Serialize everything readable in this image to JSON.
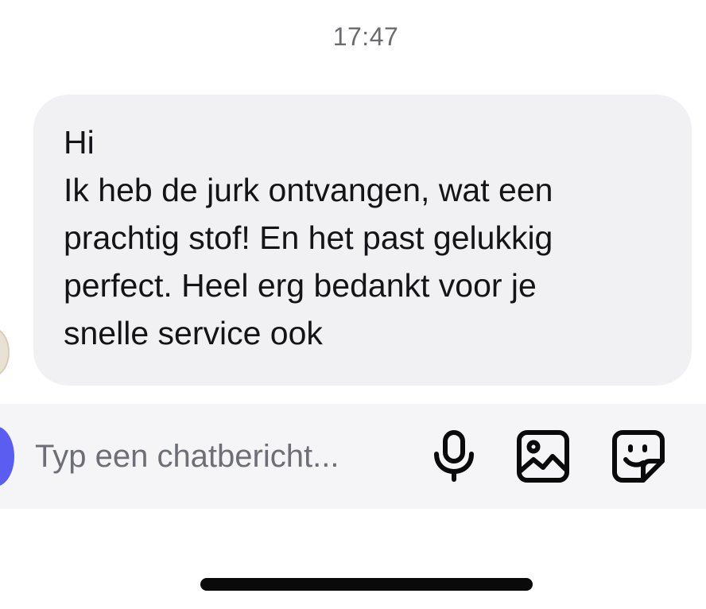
{
  "timestamp": "17:47",
  "message": {
    "text": "Hi\nIk heb de jurk ontvangen, wat een\nprachtig stof! En het past gelukkig\nperfect. Heel erg bedankt voor je\nsnelle service ook"
  },
  "composer": {
    "placeholder": "Typ een chatbericht..."
  },
  "icons": {
    "attach": "plus-button",
    "mic": "microphone-icon",
    "image": "image-icon",
    "sticker": "sticker-icon"
  },
  "colors": {
    "bubble_bg": "#f1f1f4",
    "composer_bg": "#f5f5f7",
    "accent": "#5b5cf0",
    "text": "#141418",
    "placeholder": "#6e6e76",
    "timestamp": "#6b6b70"
  }
}
